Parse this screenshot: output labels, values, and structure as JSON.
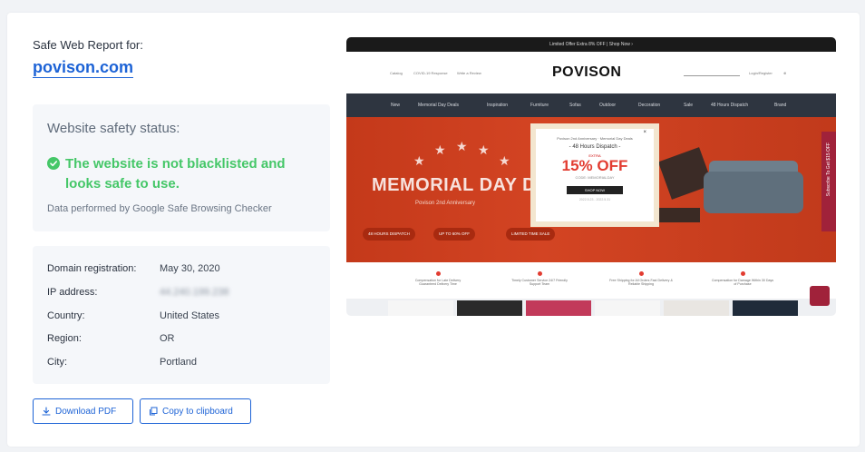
{
  "report": {
    "label": "Safe Web Report for:",
    "domain": "povison.com"
  },
  "status": {
    "title": "Website safety status:",
    "message": "The website is not blacklisted and looks safe to use.",
    "source": "Data performed by Google Safe Browsing Checker",
    "color": "#45c768"
  },
  "info": {
    "rows": [
      {
        "key": "Domain registration:",
        "value": "May 30, 2020"
      },
      {
        "key": "IP address:",
        "value": "44.240.199.238"
      },
      {
        "key": "Country:",
        "value": "United States"
      },
      {
        "key": "Region:",
        "value": "OR"
      },
      {
        "key": "City:",
        "value": "Portland"
      }
    ]
  },
  "buttons": {
    "download_pdf": "Download PDF",
    "copy_clipboard": "Copy to clipboard",
    "accent": "#1d63d6"
  },
  "screenshot": {
    "topbar": "Limited Offer Extra 8% OFF | Shop Now ›",
    "header_links": [
      "Catalog",
      "COVID-19 Response",
      "Write a Review"
    ],
    "account_text": "Login/Register",
    "logo": "POVISON",
    "nav": [
      "New",
      "Memorial Day Deals",
      "Inspiration",
      "Furniture",
      "Sofas",
      "Outdoor",
      "Decoration",
      "Sale",
      "48 Hours Dispatch",
      "Brand"
    ],
    "hero_title": "MEMORIAL DAY DEA",
    "hero_sub": "Povison 2nd Anniversary",
    "pills": [
      "48 HOURS DISPATCH",
      "UP TO 60% OFF",
      "LIMITED TIME SALE"
    ],
    "side_tab": "Subscribe To Get $15 OFF",
    "popup": {
      "heading": "Povison 2nd Anniversary · Memorial Day Deals",
      "dispatch": "- 48 Hours Dispatch -",
      "extra": "EXTRA",
      "offer": "15% OFF",
      "code": "CODE: MEMORIALDAY",
      "cta": "SHOP NOW",
      "fine": "2022.5.23 - 2022.5.31"
    },
    "features": [
      "Compensation for Late Delivery Guaranteed Delivery Time",
      "Timely Customer Service 24/7 Friendly Support Team",
      "Free Shipping for All Orders Fast Delivery & Reliable Shipping",
      "Compensation for Damage Within 30 Days of Purchase"
    ]
  }
}
